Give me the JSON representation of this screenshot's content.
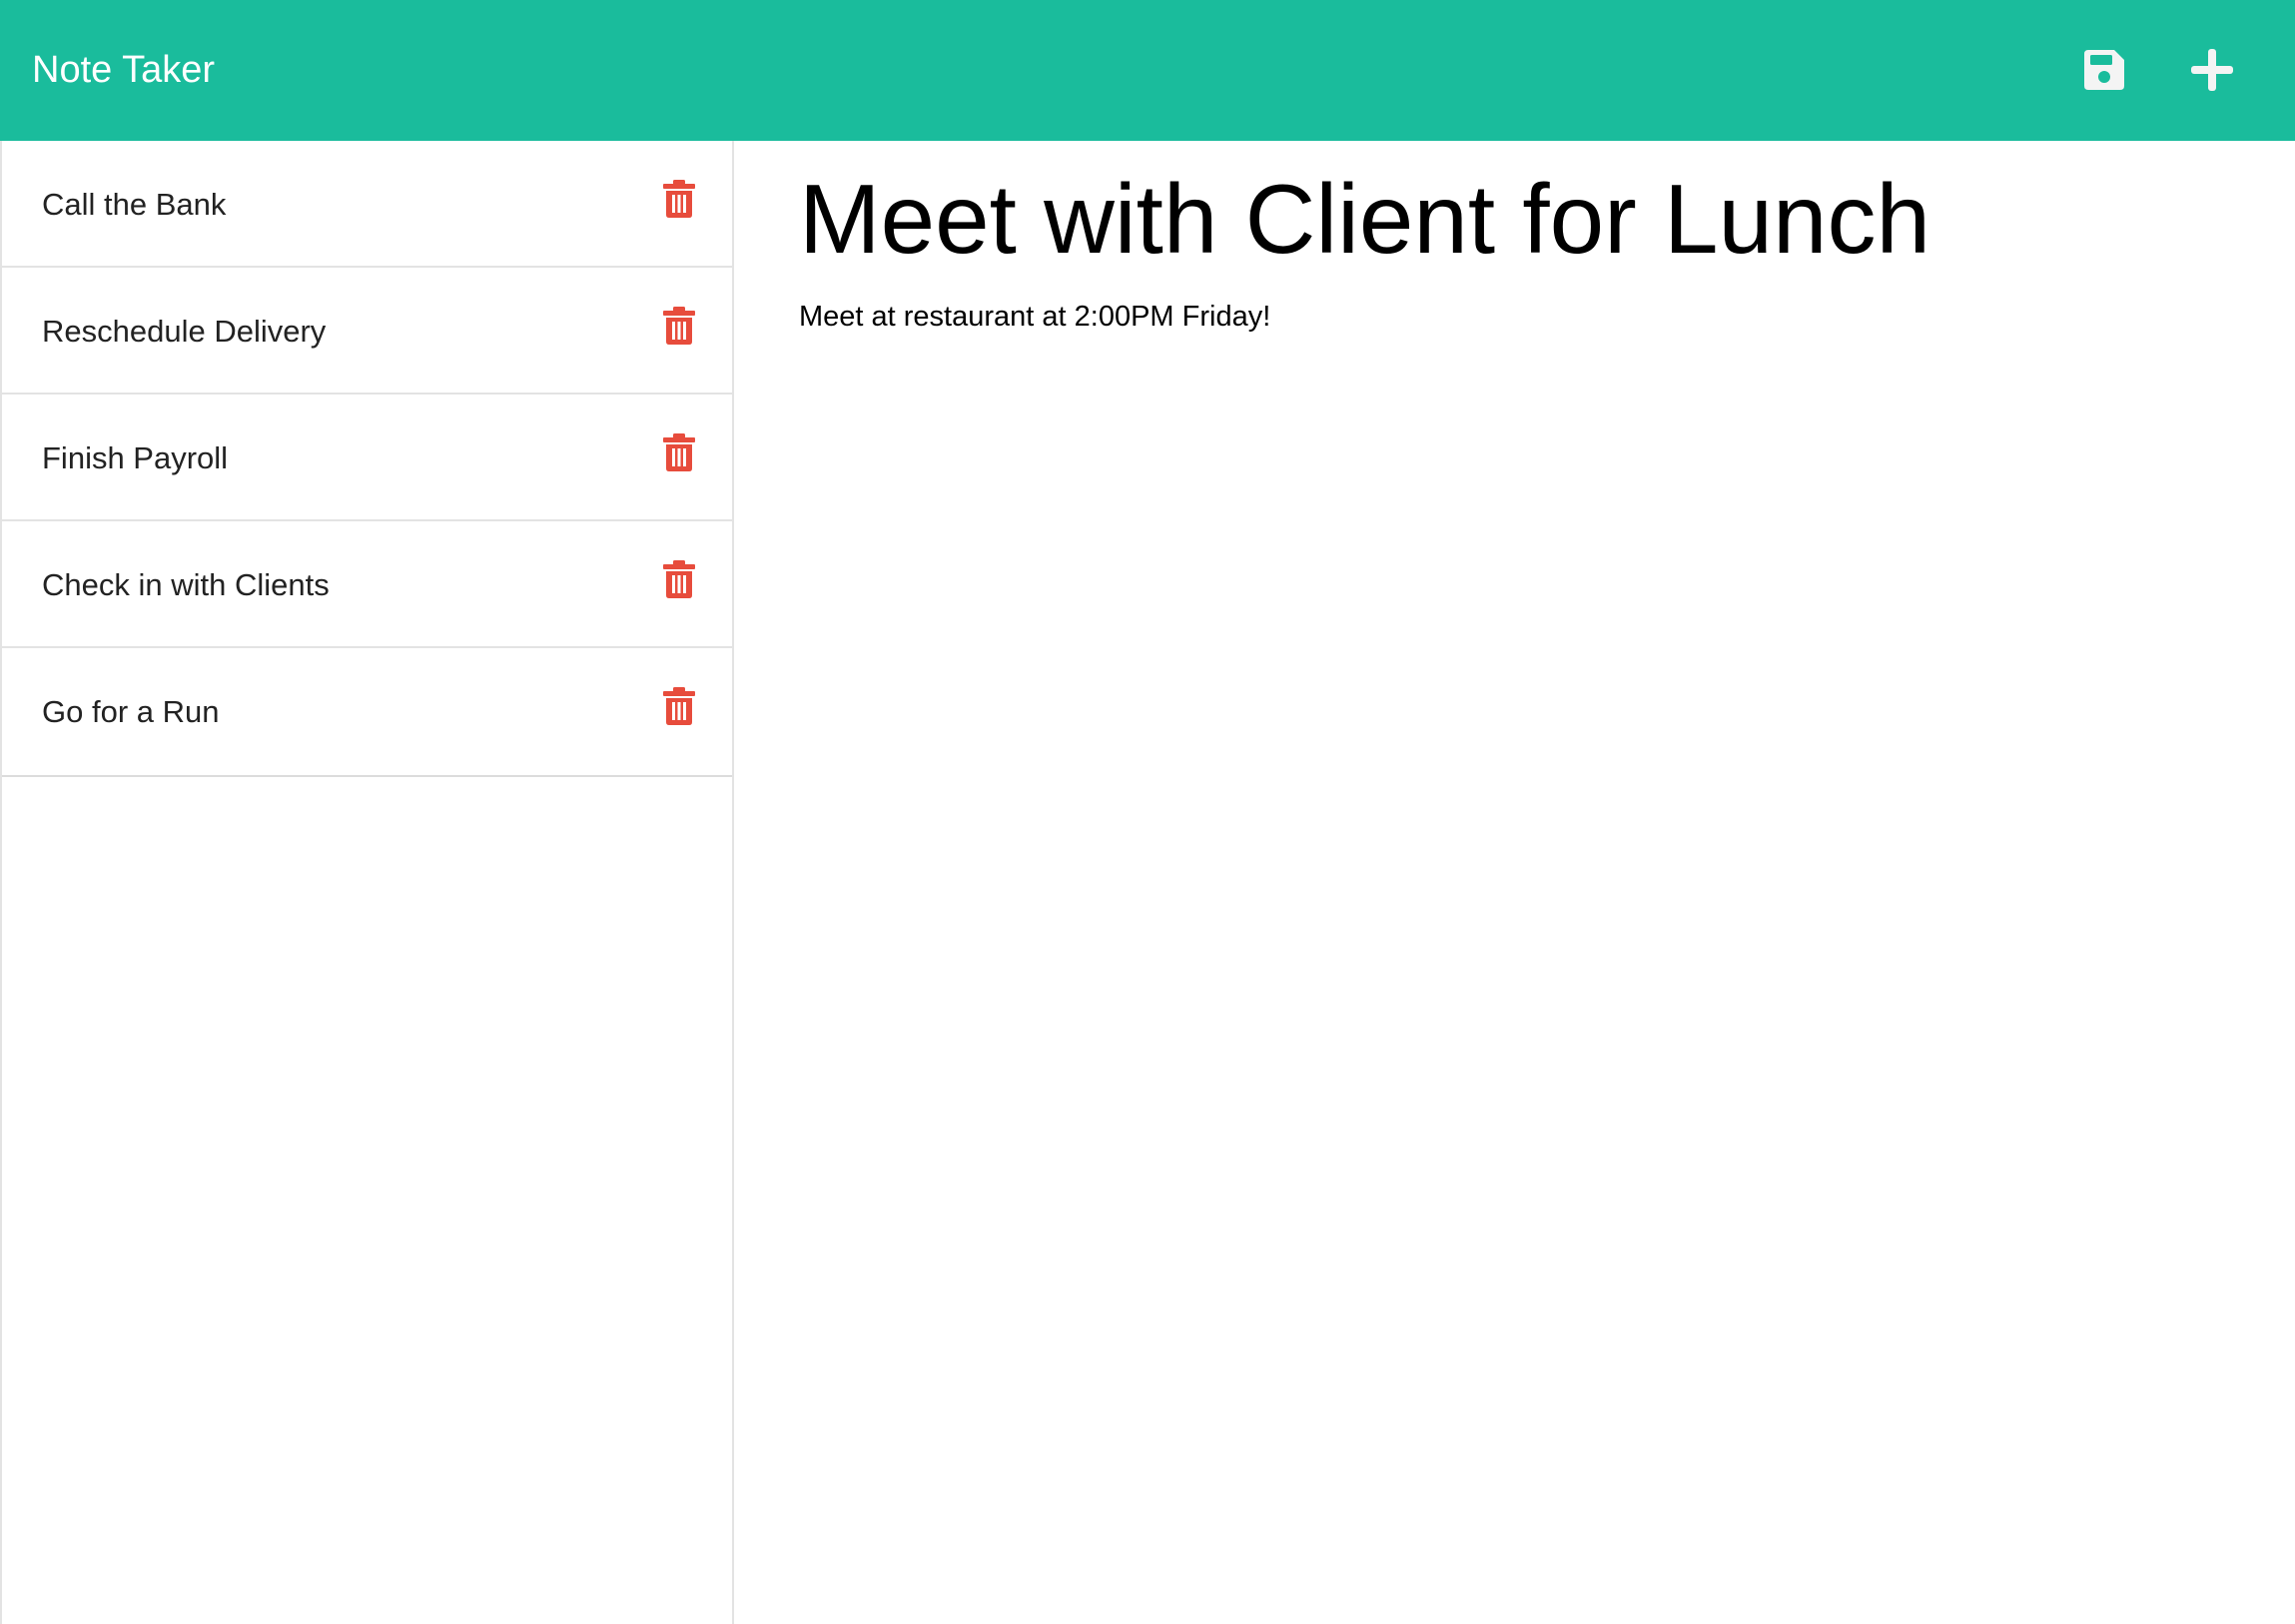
{
  "app": {
    "title": "Note Taker",
    "accent_color": "#1abc9c",
    "delete_color": "#e74c3c"
  },
  "toolbar": {
    "save_icon": "floppy-disk-icon",
    "add_icon": "plus-icon"
  },
  "notes": [
    {
      "title": "Call the Bank",
      "icon": "trash-icon"
    },
    {
      "title": "Reschedule Delivery",
      "icon": "trash-icon"
    },
    {
      "title": "Finish Payroll",
      "icon": "trash-icon"
    },
    {
      "title": "Check in with Clients",
      "icon": "trash-icon"
    },
    {
      "title": "Go for a Run",
      "icon": "trash-icon"
    }
  ],
  "active_note": {
    "title": "Meet with Client for Lunch",
    "text": "Meet at restaurant at 2:00PM Friday!"
  }
}
